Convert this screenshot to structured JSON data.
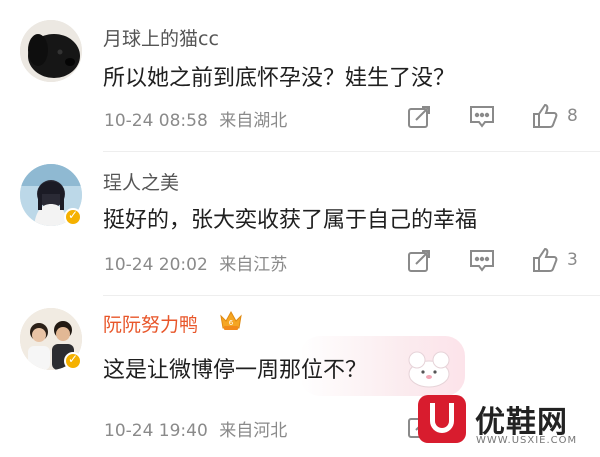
{
  "comments": [
    {
      "username": "月球上的猫cc",
      "text": "所以她之前到底怀孕没？娃生了没？",
      "date": "10-24 08:58",
      "location": "来自湖北",
      "likes": "8",
      "avatar_icon": "black-puppy-avatar"
    },
    {
      "username": "珵人之美",
      "text": "挺好的，张大奕收获了属于自己的幸福",
      "date": "10-24 20:02",
      "location": "来自江苏",
      "likes": "3",
      "avatar_icon": "illustrated-girl-avatar",
      "verified": true
    },
    {
      "username": "阮阮努力鸭",
      "text": "这是让微博停一周那位不？",
      "date": "10-24 19:40",
      "location": "来自河北",
      "likes": "",
      "avatar_icon": "couple-photo-avatar",
      "verified": true,
      "vip": true
    }
  ],
  "watermark": {
    "title": "优鞋网",
    "url": "WWW.USXIE.COM"
  },
  "colors": {
    "name_default": "#555555",
    "name_vip": "#e8562a",
    "meta": "#8a8a8a",
    "badge": "#f5b100",
    "watermark_red": "#d81c2e"
  }
}
